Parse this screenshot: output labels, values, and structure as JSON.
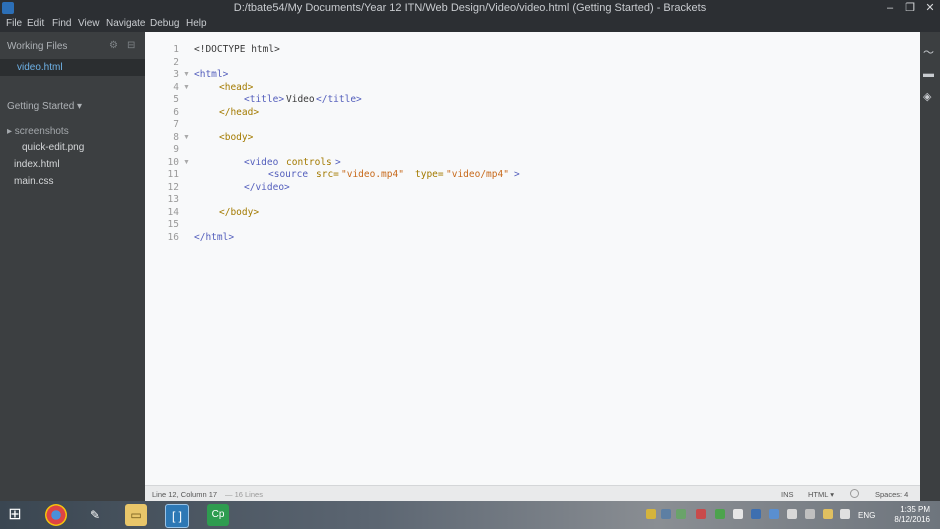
{
  "window": {
    "title": "D:/tbate54/My Documents/Year 12 ITN/Web Design/Video/video.html (Getting Started) - Brackets",
    "minimize": "–",
    "restore": "❐",
    "close": "✕"
  },
  "menu": [
    "File",
    "Edit",
    "Find",
    "View",
    "Navigate",
    "Debug",
    "Help"
  ],
  "sidebar": {
    "working_files_header": "Working Files",
    "working_files": [
      "video.html"
    ],
    "project_header": "Getting Started ▾",
    "tree": [
      {
        "label": "▸ screenshots",
        "kind": "folder"
      },
      {
        "label": "quick-edit.png",
        "kind": "file"
      },
      {
        "label": "index.html",
        "kind": "file"
      },
      {
        "label": "main.css",
        "kind": "file"
      }
    ]
  },
  "editor": {
    "line_numbers": [
      "1",
      "2",
      "3",
      "4",
      "5",
      "6",
      "7",
      "8",
      "9",
      "10",
      "11",
      "12",
      "13",
      "14",
      "15",
      "16"
    ],
    "lines": {
      "l1": "<!DOCTYPE html>",
      "l3_open": "<html>",
      "l4_open": "<head>",
      "l5_open": "<title>",
      "l5_text": "Video",
      "l5_close": "</title>",
      "l6": "</head>",
      "l8": "<body>",
      "l10_tag": "<video",
      "l10_attr": "controls",
      "l10_end": ">",
      "l11_tag": "<source",
      "l11_attr1": "src=",
      "l11_val1": "\"video.mp4\"",
      "l11_attr2": "type=",
      "l11_val2": "\"video/mp4\"",
      "l11_end": ">",
      "l12": "</video>",
      "l14": "</body>",
      "l16": "</html>"
    }
  },
  "status": {
    "position": "Line 12, Column 17",
    "lines_count": "— 16 Lines",
    "mode_ins": "INS",
    "language": "HTML ▾",
    "spaces": "Spaces: 4"
  },
  "taskbar": {
    "lang": "ENG",
    "time": "1:35 PM",
    "date": "8/12/2016"
  }
}
